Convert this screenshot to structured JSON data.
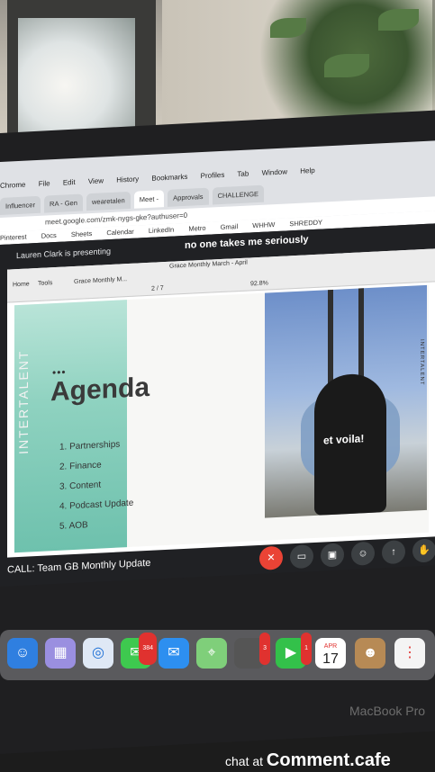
{
  "menu": [
    "Chrome",
    "File",
    "Edit",
    "View",
    "History",
    "Bookmarks",
    "Profiles",
    "Tab",
    "Window",
    "Help"
  ],
  "tabs": [
    "Influencer",
    "RA - Gen",
    "wearetalen",
    "Meet -",
    "Approvals",
    "CHALLENGE"
  ],
  "url": "meet.google.com/zmk-nygs-gke?authuser=0",
  "bookmarks": [
    "Pinterest",
    "Docs",
    "Sheets",
    "Calendar",
    "LinkedIn",
    "Metro",
    "Gmail",
    "WHHW",
    "SHREDDY"
  ],
  "presenting": "Lauren Clark is presenting",
  "caption": "no one takes me seriously",
  "pdf_title": "Grace Monthly March - April",
  "pdf_tabs": [
    "Home",
    "Tools",
    "Grace Monthly M..."
  ],
  "zoom": "92.8%",
  "page": "2 / 7",
  "slide": {
    "brand": "INTERTALENT",
    "title": "Agenda",
    "items": [
      "1. Partnerships",
      "2. Finance",
      "3. Content",
      "4. Podcast Update",
      "5. AOB"
    ],
    "photo_text": "et voila!"
  },
  "call_label": "CALL: Team GB Monthly Update",
  "dock": {
    "messages_badge": "384",
    "badge_2": "3",
    "badge_3": "1",
    "calendar_month": "APR",
    "calendar_day": "17"
  },
  "laptop_brand": "MacBook Pro",
  "watermark_prefix": "chat at",
  "watermark_site": "Comment.cafe"
}
